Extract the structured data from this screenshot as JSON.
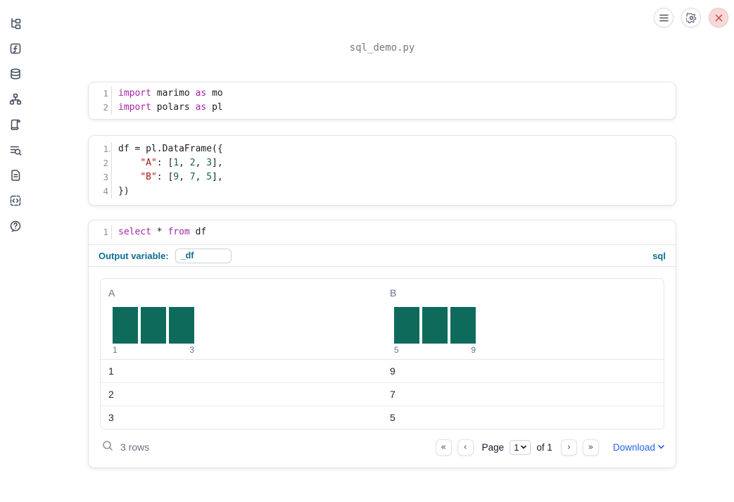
{
  "app": {
    "title": "sql_demo.py"
  },
  "sidebar": {
    "items": [
      {
        "icon": "file-explorer-icon"
      },
      {
        "icon": "variables-icon"
      },
      {
        "icon": "datasources-icon"
      },
      {
        "icon": "dependency-graph-icon"
      },
      {
        "icon": "logs-icon"
      },
      {
        "icon": "outline-search-icon"
      },
      {
        "icon": "documentation-icon"
      },
      {
        "icon": "snippets-icon"
      },
      {
        "icon": "help-icon"
      }
    ]
  },
  "header": {
    "buttons": [
      {
        "icon": "menu-icon"
      },
      {
        "icon": "gear-icon"
      },
      {
        "icon": "close-icon",
        "color": "#c75b5b",
        "background": "#fad8d8"
      }
    ]
  },
  "cells": [
    {
      "type": "python",
      "lines": [
        {
          "num": "1",
          "tokens": [
            [
              "keyword",
              "import"
            ],
            [
              "plain",
              " marimo "
            ],
            [
              "keyword",
              "as"
            ],
            [
              "plain",
              " mo"
            ]
          ]
        },
        {
          "num": "2",
          "tokens": [
            [
              "keyword",
              "import"
            ],
            [
              "plain",
              " polars "
            ],
            [
              "keyword",
              "as"
            ],
            [
              "plain",
              " pl"
            ]
          ]
        }
      ]
    },
    {
      "type": "python",
      "lines": [
        {
          "num": "1",
          "fold": true,
          "tokens": [
            [
              "plain",
              "df = pl.DataFrame({"
            ]
          ]
        },
        {
          "num": "2",
          "tokens": [
            [
              "plain",
              "    "
            ],
            [
              "string",
              "\"A\""
            ],
            [
              "plain",
              ": ["
            ],
            [
              "number",
              "1"
            ],
            [
              "plain",
              ", "
            ],
            [
              "number",
              "2"
            ],
            [
              "plain",
              ", "
            ],
            [
              "number",
              "3"
            ],
            [
              "plain",
              "],"
            ]
          ]
        },
        {
          "num": "3",
          "tokens": [
            [
              "plain",
              "    "
            ],
            [
              "string",
              "\"B\""
            ],
            [
              "plain",
              ": ["
            ],
            [
              "number",
              "9"
            ],
            [
              "plain",
              ", "
            ],
            [
              "number",
              "7"
            ],
            [
              "plain",
              ", "
            ],
            [
              "number",
              "5"
            ],
            [
              "plain",
              "],"
            ]
          ]
        },
        {
          "num": "4",
          "tokens": [
            [
              "plain",
              "})"
            ]
          ]
        }
      ]
    },
    {
      "type": "sql",
      "lines": [
        {
          "num": "1",
          "tokens": [
            [
              "keyword",
              "select"
            ],
            [
              "plain",
              " * "
            ],
            [
              "keyword",
              "from"
            ],
            [
              "plain",
              " df"
            ]
          ]
        }
      ],
      "output_variable_label": "Output variable:",
      "output_variable_value": "_df",
      "language_badge": "sql"
    }
  ],
  "table": {
    "bar_color": "#0e6b5c",
    "columns": [
      {
        "name": "A",
        "histogram": {
          "bars": [
            1,
            1,
            1
          ],
          "min_label": "1",
          "max_label": "3"
        }
      },
      {
        "name": "B",
        "histogram": {
          "bars": [
            1,
            1,
            1
          ],
          "min_label": "5",
          "max_label": "9"
        }
      }
    ],
    "rows": [
      [
        "1",
        "9"
      ],
      [
        "2",
        "7"
      ],
      [
        "3",
        "5"
      ]
    ],
    "footer": {
      "row_count": "3 rows",
      "first_page": "«",
      "prev_page": "‹",
      "page_label": "Page",
      "page_value": "1",
      "page_total": "of 1",
      "next_page": "›",
      "last_page": "»",
      "download_label": "Download"
    }
  }
}
